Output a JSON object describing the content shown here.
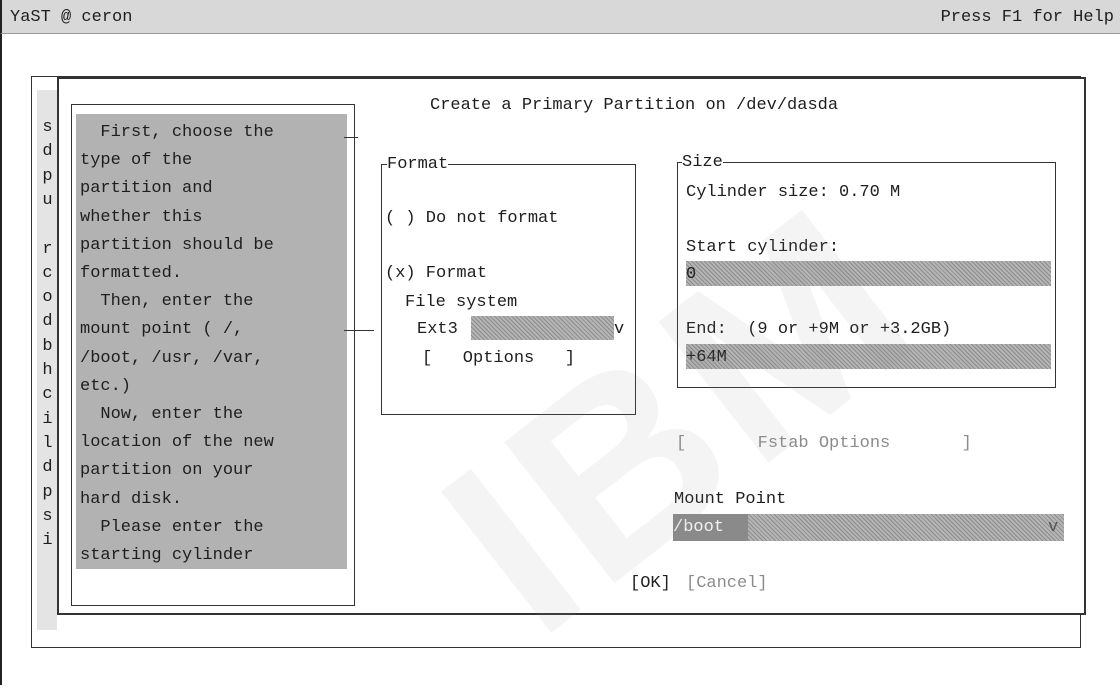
{
  "titlebar": {
    "left": "YaST @ ceron",
    "right": "Press F1 for Help"
  },
  "dialog": {
    "title": "Create a Primary Partition on /dev/dasda"
  },
  "background_column_letters": [
    "s",
    "d",
    "p",
    "u",
    "",
    "r",
    "c",
    "o",
    "d",
    "b",
    "h",
    "c",
    "i",
    "l",
    "d",
    "p",
    "s",
    "i"
  ],
  "help": {
    "lines": [
      "  First, choose the",
      "type of the",
      "partition and",
      "whether this",
      "partition should be",
      "formatted.",
      "  Then, enter the",
      "mount point ( /,",
      "/boot, /usr, /var,",
      "etc.)",
      "  Now, enter the",
      "location of the new",
      "partition on your",
      "hard disk.",
      "  Please enter the",
      "starting cylinder"
    ]
  },
  "format": {
    "legend": "Format",
    "do_not_format": "( ) Do not format",
    "format": "(x) Format",
    "fs_label": "File system",
    "fs_value": "Ext3",
    "fs_arrow": "v",
    "options_button": "[   Options   ]"
  },
  "size": {
    "legend": "Size",
    "cylinder_size": "Cylinder size: 0.70 M",
    "start_label": "Start cylinder:",
    "start_value": "0",
    "end_label": "End:  (9 or +9M or +3.2GB)",
    "end_value": "+64M"
  },
  "fstab_options_button": "[       Fstab Options       ]",
  "mount": {
    "label": "Mount Point",
    "value": "/boot",
    "arrow": "v"
  },
  "buttons": {
    "ok": "[OK]",
    "cancel": "[Cancel]"
  },
  "watermark": "IBM"
}
